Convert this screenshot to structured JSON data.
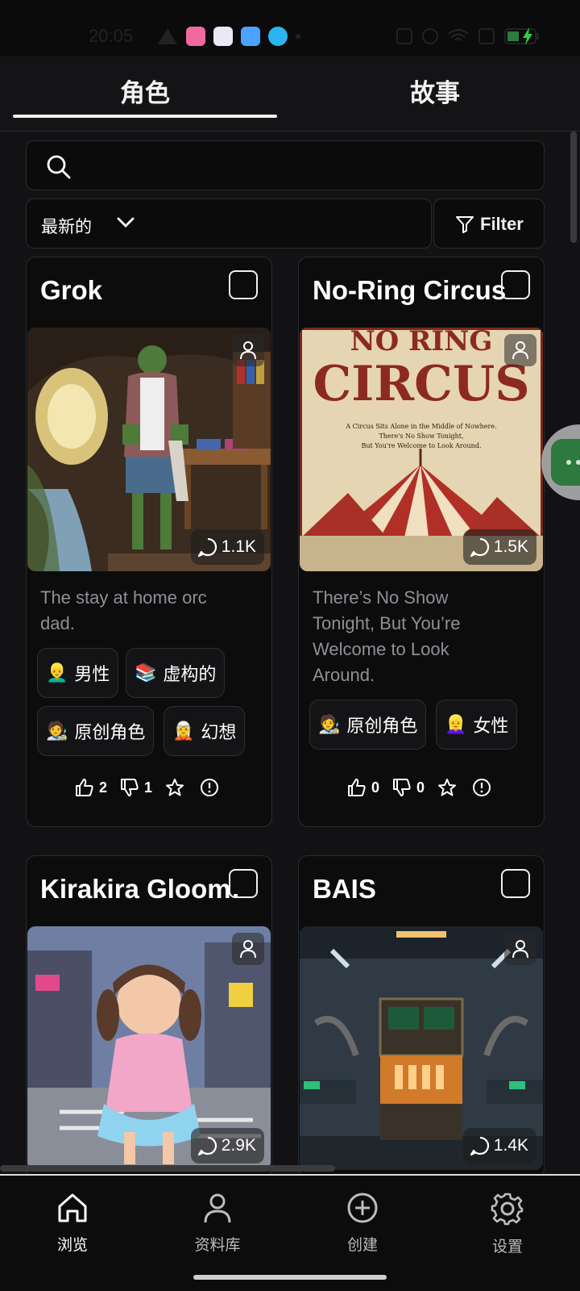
{
  "status_bar": {
    "time": "20:05"
  },
  "tabs": [
    {
      "label": "角色",
      "active": true
    },
    {
      "label": "故事",
      "active": false
    }
  ],
  "search": {
    "placeholder": ""
  },
  "sort": {
    "selected": "最新的"
  },
  "filter": {
    "label": "Filter"
  },
  "cards": [
    {
      "title": "Grok",
      "chat_count": "1.1K",
      "description": [
        "The stay at home orc",
        "dad."
      ],
      "tags": [
        {
          "emoji": "👱‍♂️",
          "label": "男性"
        },
        {
          "emoji": "📚",
          "label": "虚构的"
        },
        {
          "emoji": "🧑‍🎨",
          "label": "原创角色"
        },
        {
          "emoji": "🧝",
          "label": "幻想"
        }
      ],
      "likes": "2",
      "dislikes": "1"
    },
    {
      "title": "No-Ring Circus",
      "chat_count": "1.5K",
      "poster_text": {
        "line1": "NO RING",
        "line2": "CIRCUS",
        "tagline": [
          "A Circus Sits Alone in the Middle of Nowhere.",
          "There's No Show Tonight,",
          "But You're Welcome to Look Around."
        ]
      },
      "description": [
        "There’s No Show",
        "Tonight, But You’re",
        "Welcome to Look",
        "Around."
      ],
      "tags": [
        {
          "emoji": "🧑‍🎨",
          "label": "原创角色"
        },
        {
          "emoji": "👱‍♀️",
          "label": "女性"
        }
      ],
      "likes": "0",
      "dislikes": "0"
    },
    {
      "title": "Kirakira Gloom…",
      "chat_count": "2.9K"
    },
    {
      "title": "BAIS",
      "chat_count": "1.4K"
    }
  ],
  "bottom_nav": [
    {
      "label": "浏览",
      "icon": "home-icon",
      "active": true
    },
    {
      "label": "资料库",
      "icon": "person-icon",
      "active": false
    },
    {
      "label": "创建",
      "icon": "plus-circle-icon",
      "active": false
    },
    {
      "label": "设置",
      "icon": "gear-icon",
      "active": false
    }
  ],
  "colors": {
    "background": "#121214",
    "card": "#0c0c0d",
    "muted_text": "#8f9096",
    "float_button": "#2e7a3e"
  }
}
